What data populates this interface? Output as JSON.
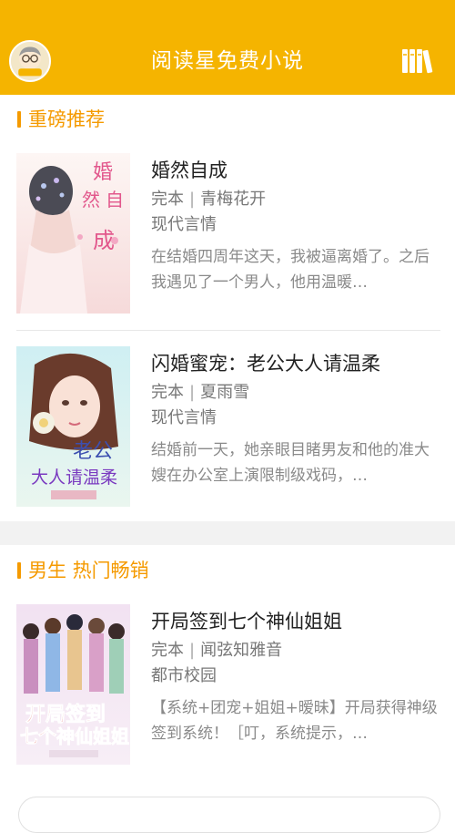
{
  "header": {
    "title": "阅读星免费小说",
    "avatar_icon": "reader-avatar-icon",
    "bookshelf_icon": "bookshelf-icon",
    "background_color": "#f5b400"
  },
  "sections": [
    {
      "title": "重磅推荐",
      "books": [
        {
          "title": "婚然自成",
          "status": "完本",
          "author": "青梅花开",
          "category": "现代言情",
          "description": "在结婚四周年这天，我被逼离婚了。之后我遇见了一个男人，他用温暖…"
        },
        {
          "title": "闪婚蜜宠：老公大人请温柔",
          "status": "完本",
          "author": "夏雨雪",
          "category": "现代言情",
          "description": "结婚前一天，她亲眼目睹男友和他的准大嫂在办公室上演限制级戏码，…"
        }
      ]
    },
    {
      "title": "男生 热门畅销",
      "books": [
        {
          "title": "开局签到七个神仙姐姐",
          "status": "完本",
          "author": "闻弦知雅音",
          "category": "都市校园",
          "description": "【系统+团宠+姐姐+暧昧】开局获得神级签到系统！［叮，系统提示，…"
        }
      ]
    }
  ],
  "colors": {
    "accent": "#f59a00",
    "title_text": "#222222",
    "meta_text": "#777777"
  }
}
